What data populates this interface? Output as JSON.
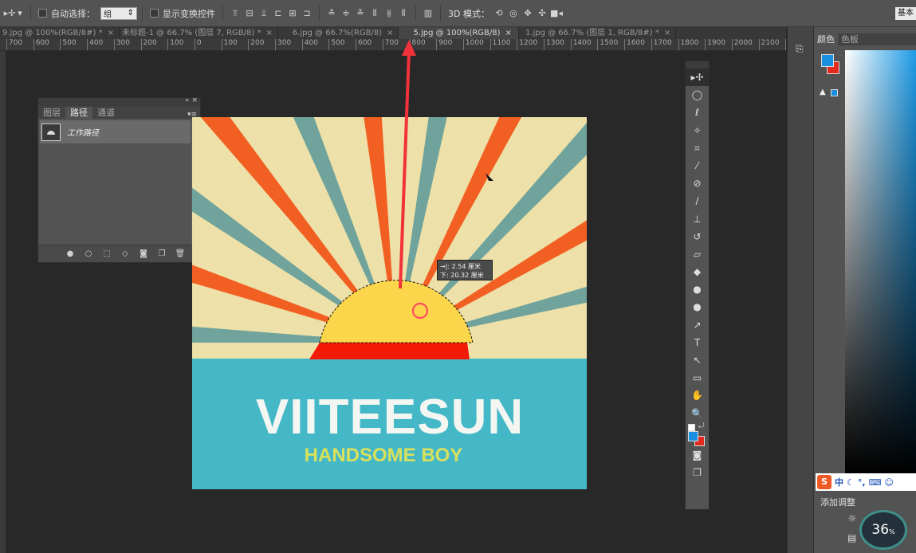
{
  "options_bar": {
    "move_tool_icon": "move-tool-icon",
    "auto_select_label": "自动选择：",
    "auto_select_value": "组",
    "show_transform_label": "显示变换控件",
    "mode_3d_label": "3D 模式：",
    "workspace_label": "基本"
  },
  "tabs": [
    {
      "label": "9.jpg @ 100%(RGB/8#) *"
    },
    {
      "label": "未标题-1 @ 66.7% (图层 7, RGB/8) *"
    },
    {
      "label": "6.jpg @ 66.7%(RGB/8)"
    },
    {
      "label": "5.jpg @ 100%(RGB/8)"
    },
    {
      "label": "1.jpg @ 66.7% (图层 1, RGB/8#) *"
    }
  ],
  "ruler_ticks": [
    "700",
    "600",
    "500",
    "400",
    "300",
    "200",
    "100",
    "0",
    "100",
    "200",
    "300",
    "400",
    "500",
    "600",
    "700",
    "800",
    "900",
    "1000",
    "1100",
    "1200",
    "1300",
    "1400",
    "1500",
    "1600",
    "1700",
    "1800",
    "1900",
    "2000",
    "2100",
    "2200"
  ],
  "paths_panel": {
    "tabs": [
      "图层",
      "路径",
      "通道"
    ],
    "active_tab": 1,
    "path_name": "工作路径"
  },
  "artwork": {
    "title": "VIITEESUN",
    "subtitle": "HANDSOME BOY",
    "colors": {
      "cream": "#ede0a8",
      "orange": "#f25f22",
      "teal": "#6fa39b",
      "sea": "#45b8c8",
      "sun": "#fcd64a",
      "red": "#f21a05"
    }
  },
  "transform_tooltip": {
    "line1_key": "→|:",
    "line1_value": "2.54 厘米",
    "line2_key": "下:",
    "line2_value": "20.32 厘米"
  },
  "toolbox": {
    "tools": [
      "move-tool",
      "elliptical-marquee-tool",
      "lasso-tool",
      "magic-wand-tool",
      "crop-tool",
      "eyedropper-tool",
      "healing-brush-tool",
      "brush-tool",
      "clone-stamp-tool",
      "history-brush-tool",
      "eraser-tool",
      "paint-bucket-tool",
      "blur-tool",
      "dodge-tool",
      "pen-tool",
      "type-tool",
      "path-selection-tool",
      "rectangle-tool",
      "hand-tool",
      "zoom-tool"
    ],
    "glyphs": [
      "▸✢",
      "◯",
      "ℓ",
      "✧",
      "⌗",
      "⁄",
      "⊘",
      "∕",
      "⊥",
      "↺",
      "▱",
      "◆",
      "●",
      "●",
      "↗",
      "T",
      "↖",
      "▭",
      "✋",
      "🔍"
    ],
    "active_index": 0
  },
  "color_panel": {
    "tabs": [
      "颜色",
      "色板"
    ],
    "foreground": "#1a8fe0",
    "background": "#e22a1e",
    "ime_label": "中",
    "adjust_label": "添加调整",
    "gauge_value": "36",
    "gauge_unit": "%"
  }
}
